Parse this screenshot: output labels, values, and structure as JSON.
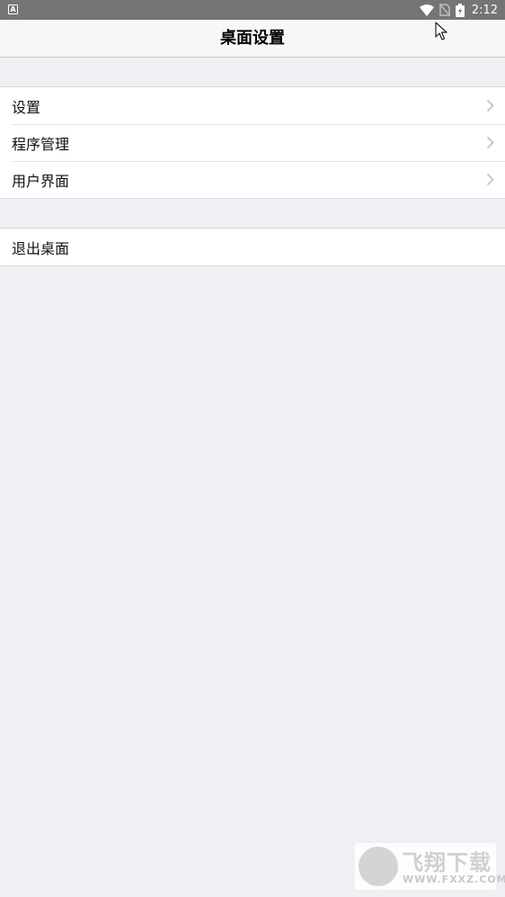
{
  "status_bar": {
    "left_icon_letter": "A",
    "time": "2:12",
    "icons": [
      "wifi-icon",
      "no-sim-icon",
      "battery-charging-icon"
    ]
  },
  "header": {
    "title": "桌面设置"
  },
  "groups": [
    {
      "items": [
        {
          "label": "设置",
          "icon": "chevron-right-icon"
        },
        {
          "label": "程序管理",
          "icon": "chevron-right-icon"
        },
        {
          "label": "用户界面",
          "icon": "chevron-right-icon"
        }
      ]
    },
    {
      "items": [
        {
          "label": "退出桌面"
        }
      ]
    }
  ],
  "watermark": {
    "text": "飞翔下载",
    "url": "WWW.FXXZ.COM"
  },
  "colors": {
    "status_bar_bg": "#757575",
    "page_bg": "#efeff4",
    "nav_bg": "#f7f7f7",
    "row_bg": "#ffffff",
    "chevron": "#c7c7cc"
  }
}
